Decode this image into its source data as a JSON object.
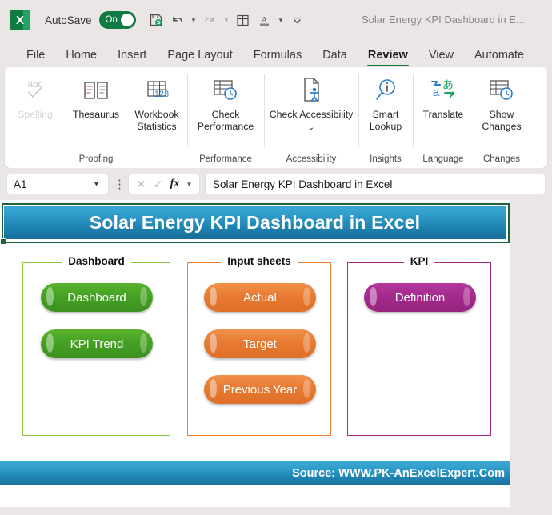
{
  "titlebar": {
    "logo_text": "X",
    "autosave_label": "AutoSave",
    "autosave_state": "On",
    "document_title": "Solar Energy KPI Dashboard in E...",
    "qat": [
      {
        "name": "save-icon",
        "glyph": "⭳"
      },
      {
        "name": "undo-icon",
        "glyph": "↶"
      },
      {
        "name": "redo-icon",
        "glyph": "↷"
      },
      {
        "name": "table-icon",
        "glyph": "⊞"
      },
      {
        "name": "font-color-icon",
        "glyph": "A"
      },
      {
        "name": "more-commands-icon",
        "glyph": "⌄"
      }
    ]
  },
  "tabs": [
    {
      "label": "File",
      "active": false
    },
    {
      "label": "Home",
      "active": false
    },
    {
      "label": "Insert",
      "active": false
    },
    {
      "label": "Page Layout",
      "active": false
    },
    {
      "label": "Formulas",
      "active": false
    },
    {
      "label": "Data",
      "active": false
    },
    {
      "label": "Review",
      "active": true
    },
    {
      "label": "View",
      "active": false
    },
    {
      "label": "Automate",
      "active": false
    }
  ],
  "ribbon": {
    "groups": [
      {
        "label": "Proofing",
        "items": [
          {
            "label": "Spelling",
            "icon": "spelling-icon",
            "disabled": true
          },
          {
            "label": "Thesaurus",
            "icon": "thesaurus-icon",
            "disabled": false
          },
          {
            "label": "Workbook Statistics",
            "icon": "workbook-statistics-icon",
            "disabled": false
          }
        ]
      },
      {
        "label": "Performance",
        "items": [
          {
            "label": "Check Performance",
            "icon": "check-performance-icon",
            "disabled": false
          }
        ]
      },
      {
        "label": "Accessibility",
        "items": [
          {
            "label": "Check Accessibility",
            "icon": "check-accessibility-icon",
            "disabled": false,
            "dropdown": true
          }
        ]
      },
      {
        "label": "Insights",
        "items": [
          {
            "label": "Smart Lookup",
            "icon": "smart-lookup-icon",
            "disabled": false
          }
        ]
      },
      {
        "label": "Language",
        "items": [
          {
            "label": "Translate",
            "icon": "translate-icon",
            "disabled": false
          }
        ]
      },
      {
        "label": "Changes",
        "items": [
          {
            "label": "Show Changes",
            "icon": "show-changes-icon",
            "disabled": false
          }
        ]
      }
    ]
  },
  "formula_bar": {
    "name_box_value": "A1",
    "cancel_icon": "✕",
    "enter_icon": "✓",
    "fx_label": "fx",
    "formula_value": "Solar Energy KPI Dashboard in Excel"
  },
  "sheet": {
    "banner_title": "Solar Energy KPI Dashboard in Excel",
    "footer_text": "Source: WWW.PK-AnExcelExpert.Com",
    "groups": [
      {
        "title": "Dashboard",
        "color": "#8dc63f",
        "style": "green",
        "buttons": [
          {
            "label": "Dashboard"
          },
          {
            "label": "KPI Trend"
          }
        ]
      },
      {
        "title": "Input sheets",
        "color": "#ec7d31",
        "style": "orange",
        "buttons": [
          {
            "label": "Actual"
          },
          {
            "label": "Target"
          },
          {
            "label": "Previous Year"
          }
        ]
      },
      {
        "title": "KPI",
        "color": "#a32a8c",
        "style": "purple",
        "buttons": [
          {
            "label": "Definition"
          }
        ]
      }
    ]
  },
  "colors": {
    "banner_top": "#3fa9d4",
    "banner_bottom": "#186d97",
    "selection": "#1e613a",
    "excel_green": "#107c41",
    "green_pill": "#44a223",
    "orange_pill": "#e87a32",
    "purple_pill": "#a32a8c"
  }
}
